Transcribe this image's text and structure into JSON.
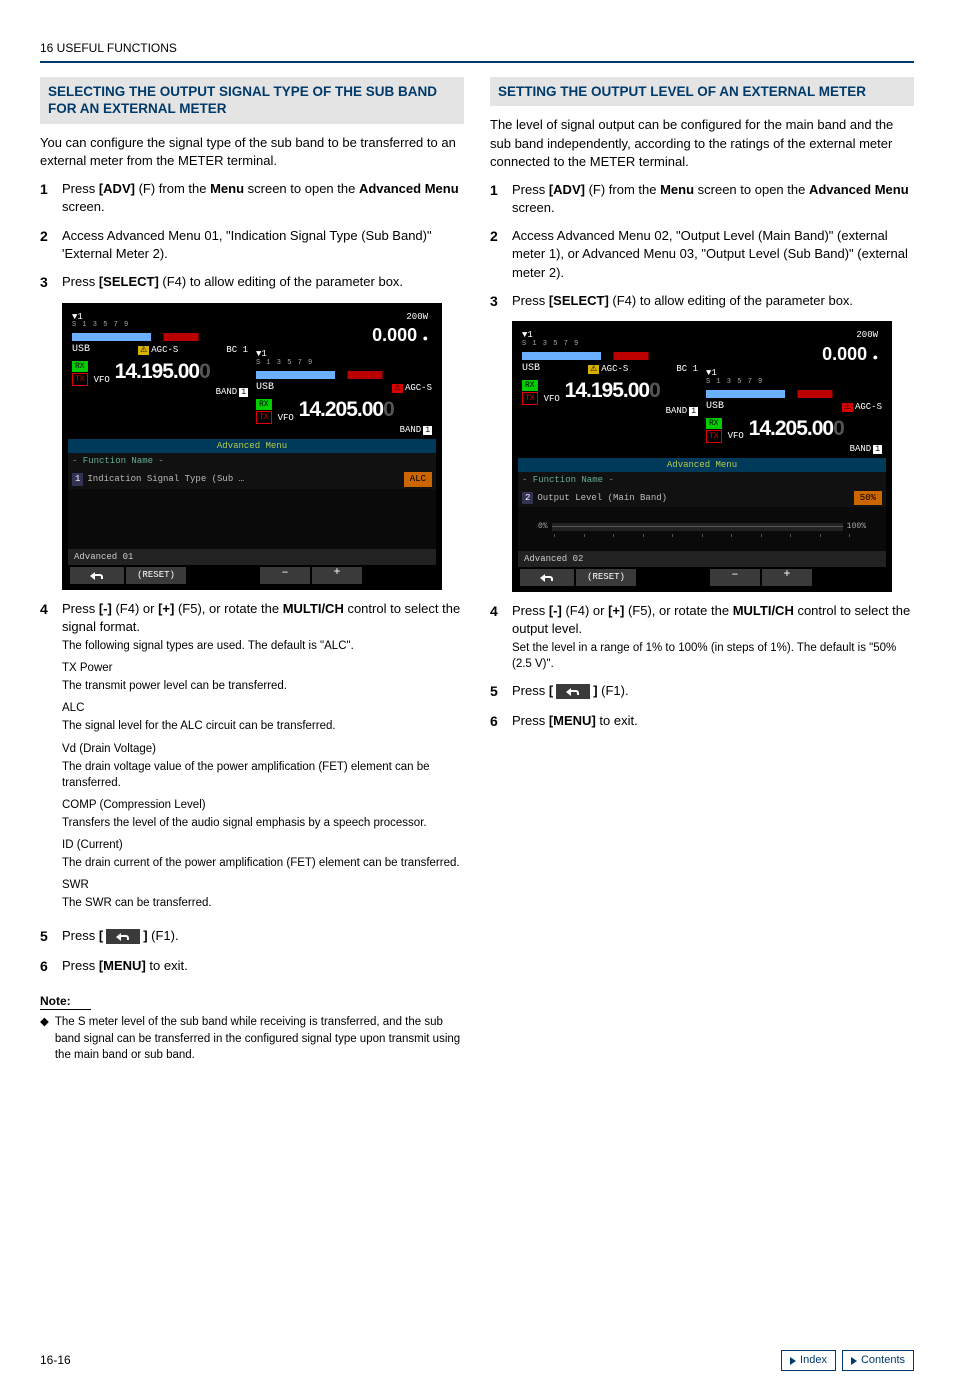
{
  "header": "16 USEFUL FUNCTIONS",
  "page_number": "16-16",
  "nav": {
    "index": "Index",
    "contents": "Contents"
  },
  "left": {
    "title": "SELECTING THE OUTPUT SIGNAL TYPE OF THE SUB BAND FOR AN EXTERNAL METER",
    "intro": "You can configure the signal type of the sub band to be transferred to an external meter from the METER terminal.",
    "steps": {
      "s1a": "Press ",
      "s1b": "[ADV]",
      "s1c": " (F) from the ",
      "s1d": "Menu",
      "s1e": " screen to open the ",
      "s1f": "Advanced Menu",
      "s1g": " screen.",
      "s2": "Access Advanced Menu 01, \"Indication Signal Type (Sub Band)\" 'External Meter 2).",
      "s3a": "Press ",
      "s3b": "[SELECT]",
      "s3c": " (F4) to allow editing of the parameter box.",
      "s4a": "Press ",
      "s4b": "[-]",
      "s4c": " (F4) or ",
      "s4d": "[+]",
      "s4e": " (F5), or rotate the ",
      "s4f": "MULTI/CH",
      "s4g": " control to select the signal format.",
      "s4sub": "The following signal types are used. The default is \"ALC\".",
      "s5a": "Press ",
      "s5b": "[",
      "s5c": "]",
      "s5d": " (F1).",
      "s6a": "Press ",
      "s6b": "[MENU]",
      "s6c": " to exit."
    },
    "signals": {
      "t1": "TX Power",
      "d1": "The transmit power level can be transferred.",
      "t2": "ALC",
      "d2": "The signal level for the ALC circuit can be transferred.",
      "t3": "Vd (Drain Voltage)",
      "d3": "The drain voltage value of the power amplification (FET) element can be transferred.",
      "t4": "COMP (Compression Level)",
      "d4": "Transfers the level of the audio signal emphasis by a speech processor.",
      "t5": "ID (Current)",
      "d5": "The drain current of the power amplification (FET) element can be transferred.",
      "t6": "SWR",
      "d6": "The SWR can be transferred."
    },
    "note_head": "Note:",
    "note_body": "The S meter level of the sub band while receiving is transferred, and the sub band signal can be transferred in the configured signal type upon transmit using the main band or sub band.",
    "shot": {
      "pwr_label": "200W",
      "pwr_val": "0.000",
      "ant": "▼1",
      "smarks": "S 1  3  5  7  9",
      "usb": "USB",
      "agc": "AGC-S",
      "bc": "BC 1",
      "rx": "RX",
      "tx": "TX",
      "vfo": "VFO",
      "freq1": "14.195.00",
      "freq1d": "0",
      "freq2": "14.205.00",
      "freq2d": "0",
      "band": "BAND",
      "b1": "1",
      "advmenu": "Advanced Menu",
      "fnrow": "-  Function Name  -",
      "item_num": "1",
      "item_label": "Indication Signal Type (Sub …",
      "item_val": "ALC",
      "advfoot": "Advanced 01",
      "reset": "(RESET)",
      "minus": "–",
      "plus": "+"
    }
  },
  "right": {
    "title": "SETTING THE OUTPUT LEVEL OF AN EXTERNAL METER",
    "intro": "The level of signal output can be configured for the main band and the sub band independently, according to the ratings of the external meter connected to the METER terminal.",
    "steps": {
      "s1a": "Press ",
      "s1b": "[ADV]",
      "s1c": " (F) from the ",
      "s1d": "Menu",
      "s1e": " screen to open the ",
      "s1f": "Advanced Menu",
      "s1g": " screen.",
      "s2": "Access Advanced Menu 02, \"Output Level (Main Band)\" (external meter 1), or Advanced Menu 03, \"Output Level (Sub Band)\" (external meter 2).",
      "s3a": "Press ",
      "s3b": "[SELECT]",
      "s3c": " (F4) to allow editing of the parameter box.",
      "s4a": "Press ",
      "s4b": "[-]",
      "s4c": " (F4) or ",
      "s4d": "[+]",
      "s4e": " (F5), or rotate the ",
      "s4f": "MULTI/CH",
      "s4g": " control to select the output level.",
      "s4sub": "Set the level in a range of 1% to 100% (in steps of 1%). The default is \"50% (2.5 V)\".",
      "s5a": "Press ",
      "s5b": "[",
      "s5c": "]",
      "s5d": " (F1).",
      "s6a": "Press ",
      "s6b": "[MENU]",
      "s6c": " to exit."
    },
    "shot": {
      "pwr_label": "200W",
      "pwr_val": "0.000",
      "ant": "▼1",
      "smarks": "S 1  3  5  7  9",
      "usb": "USB",
      "agc": "AGC-S",
      "bc": "BC 1",
      "rx": "RX",
      "tx": "TX",
      "vfo": "VFO",
      "freq1": "14.195.00",
      "freq1d": "0",
      "freq2": "14.205.00",
      "freq2d": "0",
      "band": "BAND",
      "b1": "1",
      "advmenu": "Advanced Menu",
      "fnrow": "-  Function Name  -",
      "item_num": "2",
      "item_label": "Output Level (Main Band)",
      "item_val": "50%",
      "slide_lo": "0%",
      "slide_hi": "100%",
      "advfoot": "Advanced 02",
      "reset": "(RESET)",
      "minus": "–",
      "plus": "+"
    }
  }
}
